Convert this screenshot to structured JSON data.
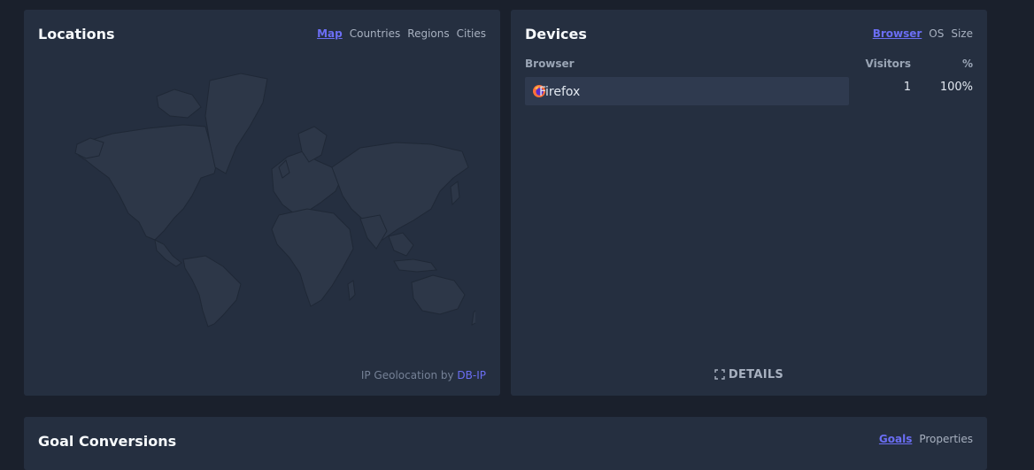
{
  "locations": {
    "title": "Locations",
    "tabs": [
      "Map",
      "Countries",
      "Regions",
      "Cities"
    ],
    "active_tab": "Map",
    "credit_prefix": "IP Geolocation by",
    "credit_link": "DB-IP"
  },
  "devices": {
    "title": "Devices",
    "tabs": [
      "Browser",
      "OS",
      "Size"
    ],
    "active_tab": "Browser",
    "columns": {
      "name": "Browser",
      "visitors": "Visitors",
      "percent": "%"
    },
    "rows": [
      {
        "icon": "firefox-icon",
        "name": "Firefox",
        "visitors": "1",
        "percent": "100%"
      }
    ],
    "details_label": "DETAILS"
  },
  "goals": {
    "title": "Goal Conversions",
    "tabs": [
      "Goals",
      "Properties"
    ],
    "active_tab": "Goals"
  },
  "colors": {
    "background": "#1a202c",
    "card": "#252f40",
    "accent": "#6b6ef4",
    "bar": "#2f3a4f"
  }
}
